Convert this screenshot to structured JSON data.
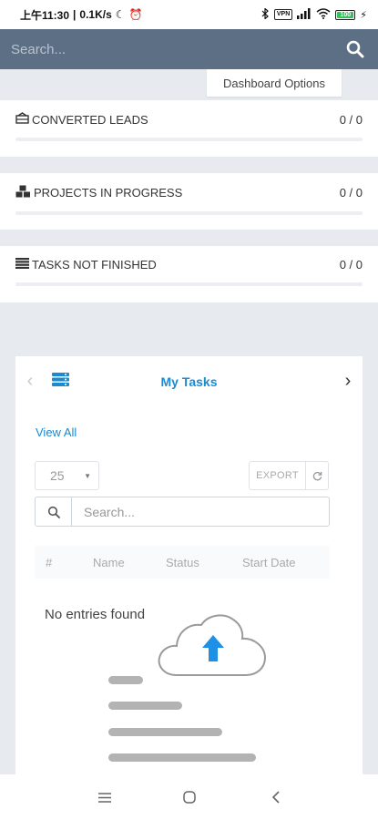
{
  "status_bar": {
    "time": "上午11:30",
    "speed": "0.1K/s",
    "vpn_label": "VPN",
    "battery_label": "100"
  },
  "header": {
    "search_placeholder": "Search..."
  },
  "dashboard_options_label": "Dashboard Options",
  "stats": [
    {
      "icon": "balance-scale-icon",
      "title": "CONVERTED LEADS",
      "value": "0 / 0",
      "progress": 0
    },
    {
      "icon": "cubes-icon",
      "title": "PROJECTS IN PROGRESS",
      "value": "0 / 0",
      "progress": 0
    },
    {
      "icon": "list-icon",
      "title": "TASKS NOT FINISHED",
      "value": "0 / 0",
      "progress": 0
    }
  ],
  "tasks_panel": {
    "title": "My Tasks",
    "view_all": "View All",
    "page_size": "25",
    "export_label": "EXPORT",
    "search_placeholder": "Search...",
    "columns": [
      "#",
      "Name",
      "Status",
      "Start Date"
    ],
    "empty_text": "No entries found"
  },
  "colors": {
    "header_bg": "#5c6f84",
    "accent_blue": "#1a8ad2",
    "upload_arrow": "#1e90e6",
    "page_bg": "#e7eaef"
  }
}
